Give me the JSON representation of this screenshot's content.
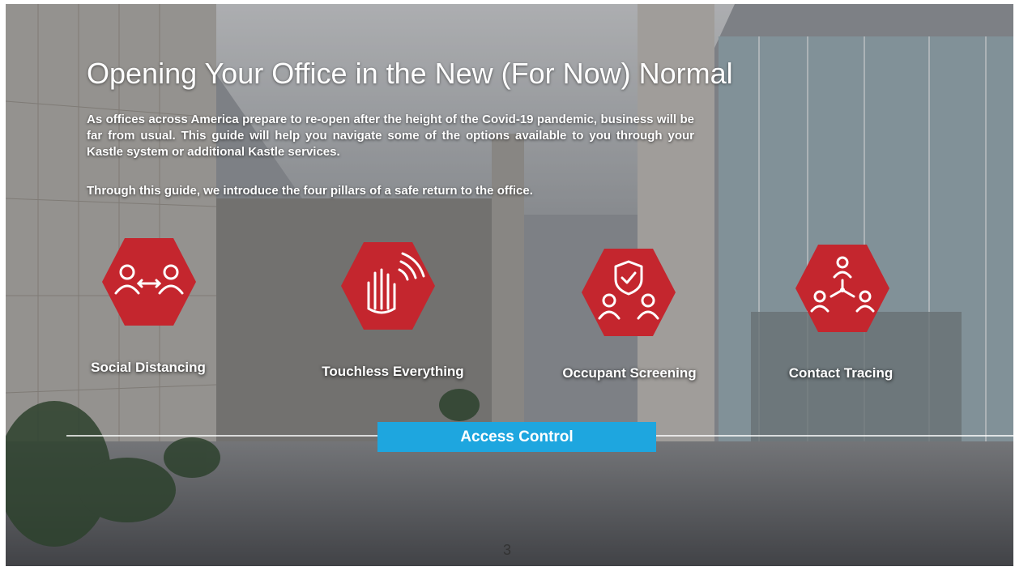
{
  "slide": {
    "title": "Opening Your Office in the New (For Now) Normal",
    "paragraph_1": "As offices across America prepare to re-open after the height of the Covid-19 pandemic, business will be far from usual. This guide will help you navigate some of the options available to you through your Kastle system or additional Kastle services.",
    "paragraph_2": "Through this guide, we introduce the four pillars of a safe return to the office.",
    "pillars": [
      {
        "label": "Social Distancing",
        "icon": "social-distancing-icon"
      },
      {
        "label": "Touchless Everything",
        "icon": "touchless-hand-icon"
      },
      {
        "label": "Occupant Screening",
        "icon": "occupant-screening-icon"
      },
      {
        "label": "Contact Tracing",
        "icon": "contact-tracing-icon"
      }
    ],
    "base_label": "Access Control",
    "page_number": "3"
  },
  "colors": {
    "hexagon": "#c4262e",
    "access_bar": "#1ea6df",
    "text": "#ffffff"
  }
}
